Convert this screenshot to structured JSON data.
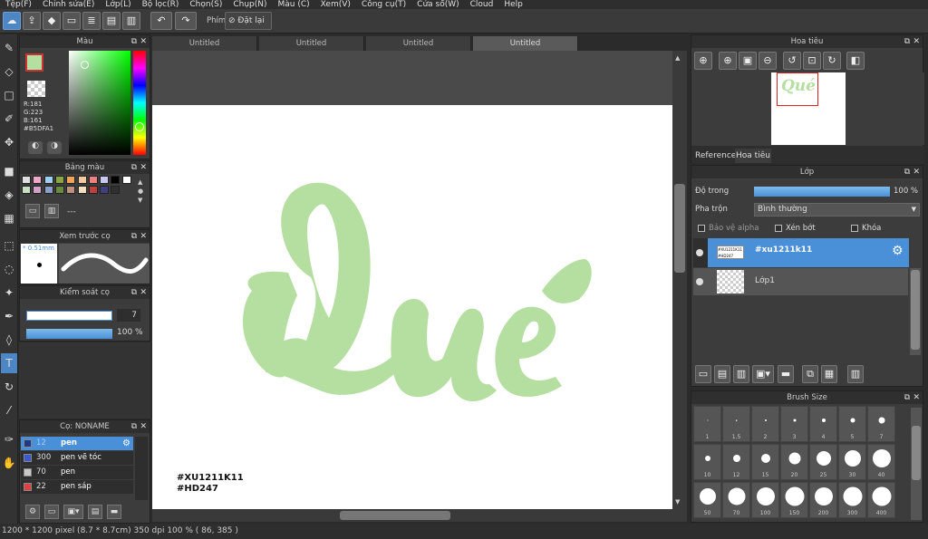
{
  "menubar": [
    "Tệp(F)",
    "Chỉnh sửa(E)",
    "Lớp(L)",
    "Bộ lọc(R)",
    "Chọn(S)",
    "Chụp(N)",
    "Màu (C)",
    "Xem(V)",
    "Công cụ(T)",
    "Cửa sổ(W)",
    "Cloud",
    "Help"
  ],
  "toolbar": {
    "phim_label": "Phím",
    "reset_label": "Đặt lại"
  },
  "color_panel": {
    "title": "Màu",
    "rgb": [
      "R:181",
      "G:223",
      "B:161"
    ],
    "hex": "#B5DFA1",
    "current_color": "#b5dfa1"
  },
  "palette_panel": {
    "title": "Bảng màu",
    "colors": [
      "#e0e0e0",
      "#f4a6c8",
      "#a0d0f0",
      "#8aa640",
      "#f2a35a",
      "#f6c8a0",
      "#f08080",
      "#c8c8f0",
      "#000000",
      "#ffffff",
      "#c8e0c0",
      "#d4a0c8",
      "#8aa0c8",
      "#6a8a40",
      "#c09080",
      "#f4e0c0",
      "#c04040",
      "#404080",
      "#303030"
    ],
    "dashes": "---"
  },
  "brush_preview": {
    "title": "Xem trước cọ",
    "size": "* 0.51mm"
  },
  "brush_control": {
    "title": "Kiểm soát cọ",
    "size_value": "7",
    "opacity_value": "100 %"
  },
  "brush_list": {
    "title": "Cọ: NONAME",
    "items": [
      {
        "size": "12",
        "name": "pen",
        "color": "#1e3a8a"
      },
      {
        "size": "300",
        "name": "pen vẽ tóc",
        "color": "#3a5bd0"
      },
      {
        "size": "70",
        "name": "pen",
        "color": "#c8c8c8"
      },
      {
        "size": "22",
        "name": "pen sáp",
        "color": "#e04040"
      }
    ]
  },
  "tabs": [
    "Untitled",
    "Untitled",
    "Untitled",
    "Untitled"
  ],
  "canvas": {
    "text_main": "Qué",
    "tag1": "#XU1211K11",
    "tag2": "#HD247",
    "lettering_color": "#b5dfa1"
  },
  "navigator": {
    "title": "Hoa tiêu",
    "tab_reference": "Reference",
    "tab_navigator": "Hoa tiêu",
    "thumb_text": "Qué"
  },
  "layer_panel": {
    "title": "Lớp",
    "opacity_label": "Độ trong",
    "opacity_value": "100 %",
    "blend_label": "Pha trộn",
    "blend_value": "Bình thường",
    "protect_alpha": "Bảo vệ alpha",
    "clipping": "Xén bớt",
    "lock": "Khóa",
    "layers": [
      {
        "name": "#xu1211k11",
        "selected": true
      },
      {
        "name": "Lớp1",
        "selected": false
      }
    ]
  },
  "brush_size": {
    "title": "Brush Size",
    "labels": [
      "1",
      "1.5",
      "2",
      "3",
      "4",
      "5",
      "7",
      "10",
      "12",
      "15",
      "20",
      "25",
      "30",
      "40",
      "50",
      "70",
      "100",
      "150",
      "200",
      "300",
      "400"
    ]
  },
  "status": "1200 * 1200 pixel   (8.7 * 8.7cm)   350 dpi   100 %   ( 86, 385 )"
}
